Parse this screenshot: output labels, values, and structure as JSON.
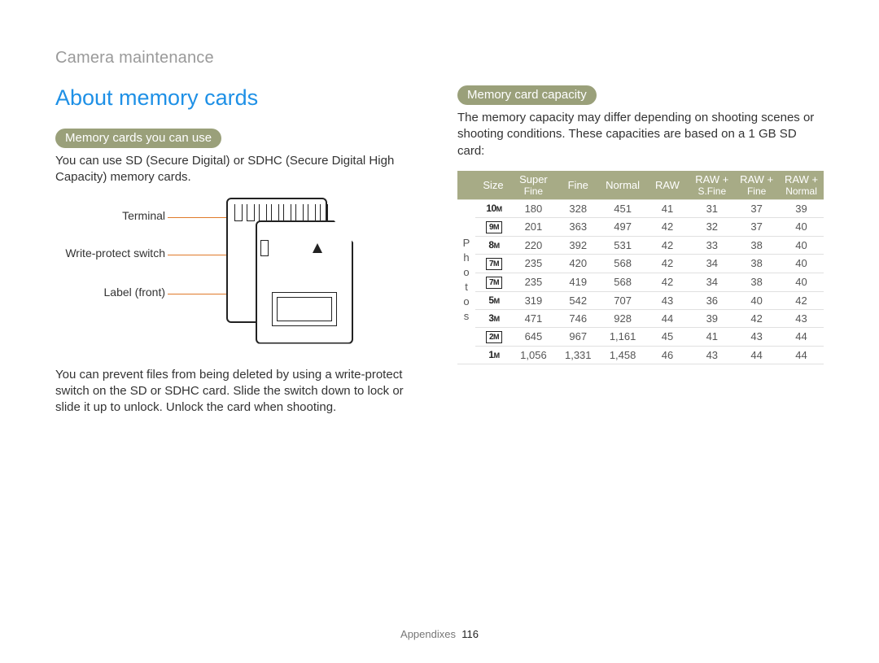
{
  "breadcrumb": "Camera maintenance",
  "title": "About memory cards",
  "left": {
    "pill": "Memory cards you can use",
    "intro": "You can use SD (Secure Digital) or SDHC (Secure Digital High Capacity) memory cards.",
    "diagram_labels": {
      "terminal": "Terminal",
      "write_protect": "Write-protect switch",
      "label_front": "Label (front)"
    },
    "protect_text": "You can prevent files from being deleted by using a write-protect switch on the SD or SDHC card. Slide the switch down to lock or slide it up to unlock. Unlock the card when shooting."
  },
  "right": {
    "pill": "Memory card capacity",
    "intro": "The memory capacity may differ depending on shooting scenes or shooting conditions. These capacities are based on a 1 GB SD card:",
    "row_group_label": "Photos"
  },
  "chart_data": {
    "type": "table",
    "title": "Memory card capacity (1 GB SD card)",
    "row_group": "Photos",
    "columns": [
      "Size",
      "Super Fine",
      "Fine",
      "Normal",
      "RAW",
      "RAW + S.Fine",
      "RAW + Fine",
      "RAW + Normal"
    ],
    "rows": [
      {
        "size": "10M",
        "badge": false,
        "values": [
          180,
          328,
          451,
          41,
          31,
          37,
          39
        ]
      },
      {
        "size": "9M",
        "badge": true,
        "values": [
          201,
          363,
          497,
          42,
          32,
          37,
          40
        ]
      },
      {
        "size": "8M",
        "badge": false,
        "values": [
          220,
          392,
          531,
          42,
          33,
          38,
          40
        ]
      },
      {
        "size": "7M",
        "badge": true,
        "values": [
          235,
          420,
          568,
          42,
          34,
          38,
          40
        ]
      },
      {
        "size": "7M",
        "badge": true,
        "values": [
          235,
          419,
          568,
          42,
          34,
          38,
          40
        ]
      },
      {
        "size": "5M",
        "badge": false,
        "values": [
          319,
          542,
          707,
          43,
          36,
          40,
          42
        ]
      },
      {
        "size": "3M",
        "badge": false,
        "values": [
          471,
          746,
          928,
          44,
          39,
          42,
          43
        ]
      },
      {
        "size": "2M",
        "badge": true,
        "values": [
          645,
          967,
          1161,
          45,
          41,
          43,
          44
        ]
      },
      {
        "size": "1M",
        "badge": false,
        "values": [
          1056,
          1331,
          1458,
          46,
          43,
          44,
          44
        ]
      }
    ]
  },
  "footer": {
    "section": "Appendixes",
    "page": "116"
  }
}
